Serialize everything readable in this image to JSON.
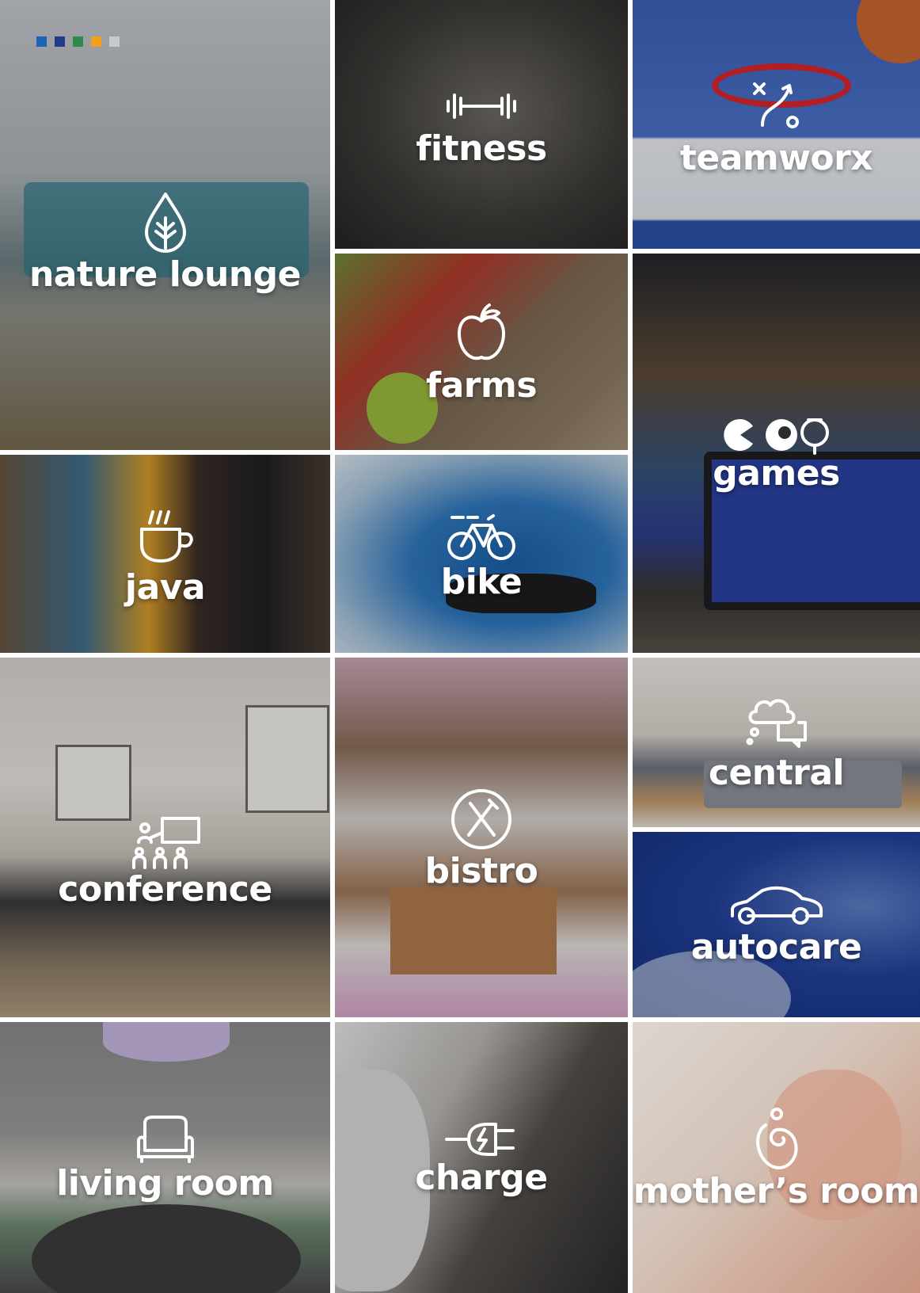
{
  "brand_squares": [
    "#1c62b8",
    "#213a8c",
    "#2e8a4a",
    "#f2a01c",
    "#c9c9c9"
  ],
  "tiles": [
    {
      "id": "nature",
      "label": "nature lounge",
      "icon": "leaf-drop-icon"
    },
    {
      "id": "fitness",
      "label": "fitness",
      "icon": "dumbbell-icon"
    },
    {
      "id": "teamworx",
      "label": "teamworx",
      "icon": "play-strategy-icon"
    },
    {
      "id": "farms",
      "label": "farms",
      "icon": "apple-icon"
    },
    {
      "id": "games",
      "label": "games",
      "icon": "pacman-billiard-ball-icon"
    },
    {
      "id": "java",
      "label": "java",
      "icon": "coffee-cup-icon"
    },
    {
      "id": "bike",
      "label": "bike",
      "icon": "bicycle-icon"
    },
    {
      "id": "conference",
      "label": "conference",
      "icon": "presentation-audience-icon"
    },
    {
      "id": "bistro",
      "label": "bistro",
      "icon": "fork-knife-icon"
    },
    {
      "id": "central",
      "label": "central",
      "icon": "thought-chat-bubbles-icon"
    },
    {
      "id": "autocare",
      "label": "autocare",
      "icon": "car-icon"
    },
    {
      "id": "living",
      "label": "living room",
      "icon": "armchair-icon"
    },
    {
      "id": "charge",
      "label": "charge",
      "icon": "ev-plug-icon"
    },
    {
      "id": "mother",
      "label": "mother’s room",
      "icon": "mother-baby-icon"
    }
  ]
}
